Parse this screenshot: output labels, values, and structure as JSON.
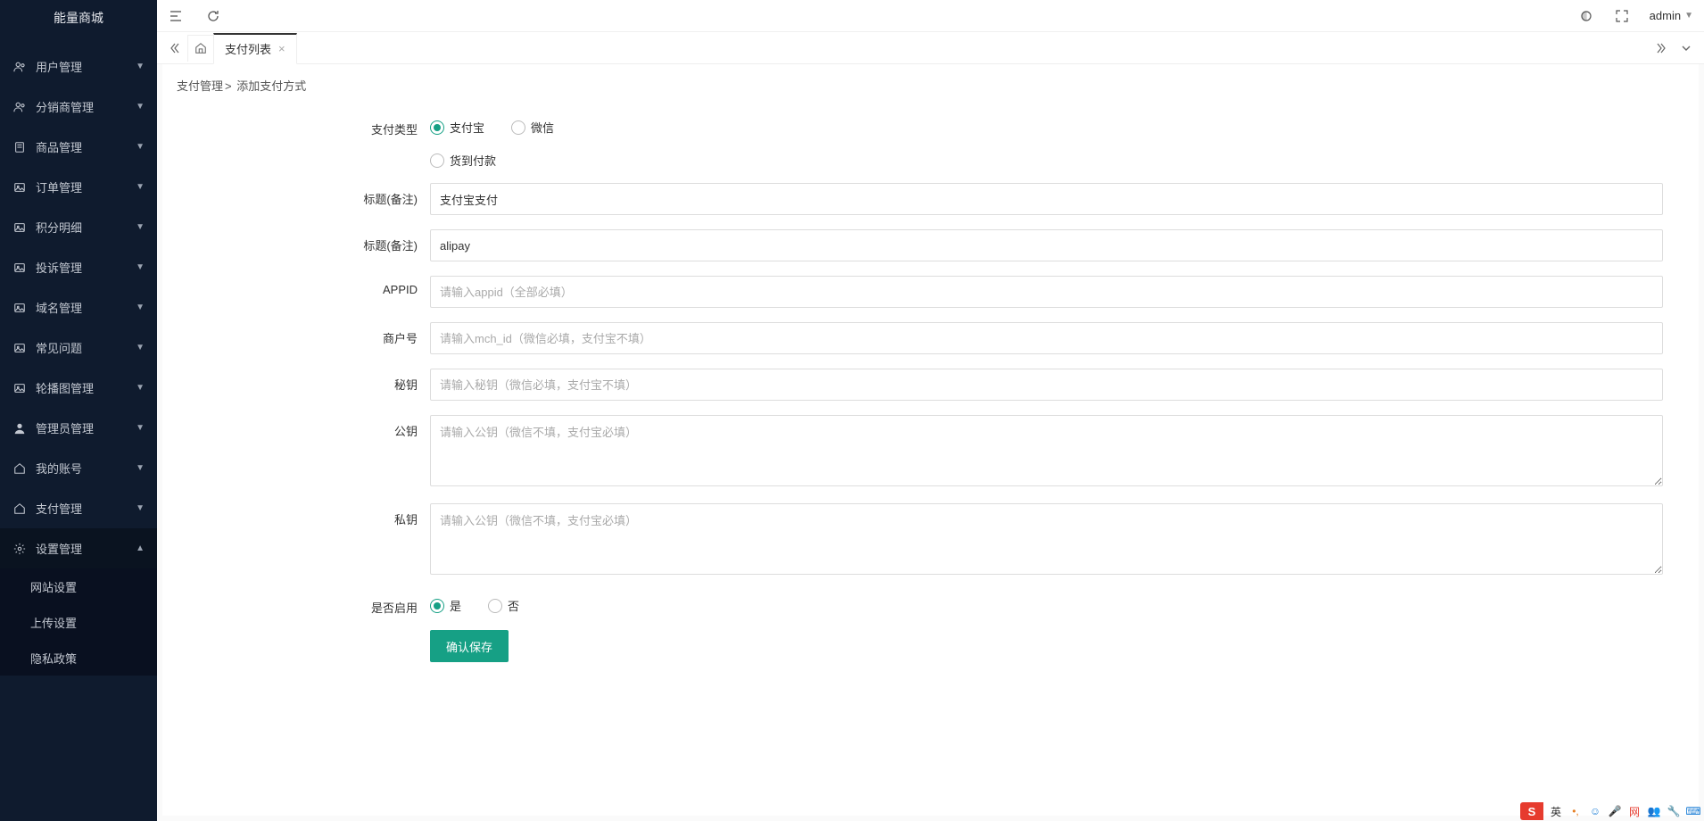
{
  "app_title": "能量商城",
  "header": {
    "admin_label": "admin"
  },
  "sidebar": {
    "items": [
      {
        "icon": "users",
        "label": "用户管理"
      },
      {
        "icon": "users",
        "label": "分销商管理"
      },
      {
        "icon": "doc",
        "label": "商品管理"
      },
      {
        "icon": "image",
        "label": "订单管理"
      },
      {
        "icon": "image",
        "label": "积分明细"
      },
      {
        "icon": "image",
        "label": "投诉管理"
      },
      {
        "icon": "image",
        "label": "域名管理"
      },
      {
        "icon": "image",
        "label": "常见问题"
      },
      {
        "icon": "image",
        "label": "轮播图管理"
      },
      {
        "icon": "user",
        "label": "管理员管理"
      },
      {
        "icon": "home",
        "label": "我的账号"
      },
      {
        "icon": "home",
        "label": "支付管理"
      },
      {
        "icon": "gear",
        "label": "设置管理"
      }
    ],
    "sub_items": [
      {
        "label": "网站设置"
      },
      {
        "label": "上传设置"
      },
      {
        "label": "隐私政策"
      }
    ]
  },
  "tabs": {
    "active_label": "支付列表"
  },
  "breadcrumb": {
    "p1": "支付管理",
    "p2": "添加支付方式"
  },
  "form": {
    "pay_type_label": "支付类型",
    "pay_type_options": {
      "alipay": "支付宝",
      "wechat": "微信",
      "cod": "货到付款"
    },
    "title_remark_label": "标题(备注)",
    "title_value": "支付宝支付",
    "title_remark2_label": "标题(备注)",
    "code_value": "alipay",
    "appid_label": "APPID",
    "appid_placeholder": "请输入appid（全部必填）",
    "mch_label": "商户号",
    "mch_placeholder": "请输入mch_id（微信必填，支付宝不填）",
    "secret_label": "秘钥",
    "secret_placeholder": "请输入秘钥（微信必填，支付宝不填）",
    "pubkey_label": "公钥",
    "pubkey_placeholder": "请输入公钥（微信不填，支付宝必填）",
    "prikey_label": "私钥",
    "prikey_placeholder": "请输入公钥（微信不填，支付宝必填）",
    "enable_label": "是否启用",
    "enable_yes": "是",
    "enable_no": "否",
    "submit_label": "确认保存"
  },
  "ime": {
    "badge": "S",
    "lang": "英"
  }
}
